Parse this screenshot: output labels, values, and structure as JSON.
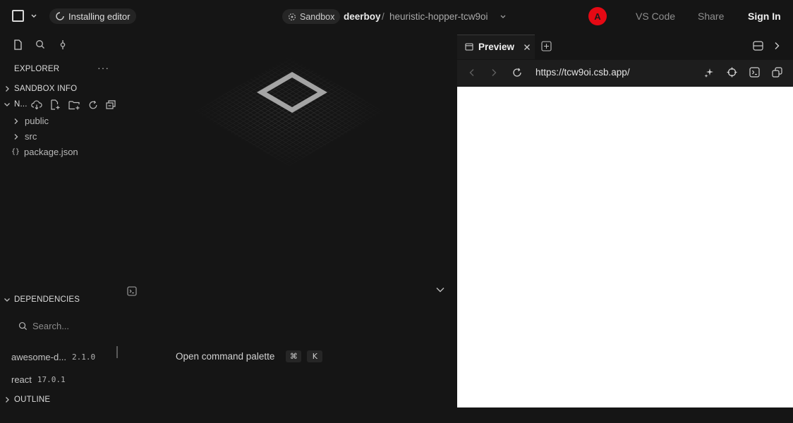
{
  "header": {
    "install_status": "Installing editor",
    "sandbox_label": "Sandbox",
    "owner": "deerboy",
    "separator": "/",
    "sandbox_name": "heuristic-hopper-tcw9oi",
    "avatar_initial": "A",
    "avatar_color": "#e50914",
    "vscode_label": "VS Code",
    "share_label": "Share",
    "signin_label": "Sign In"
  },
  "sidebar": {
    "explorer_title": "EXPLORER",
    "more_label": "···",
    "sandbox_info": "SANDBOX INFO",
    "folder_label": "N...",
    "files": [
      {
        "name": "public",
        "type": "folder"
      },
      {
        "name": "src",
        "type": "folder"
      },
      {
        "name": "package.json",
        "type": "json"
      }
    ],
    "dependencies_title": "DEPENDENCIES",
    "search_placeholder": "Search...",
    "dependencies": [
      {
        "name": "awesome-d...",
        "version": "2.1.0"
      },
      {
        "name": "react",
        "version": "17.0.1"
      }
    ],
    "outline_title": "OUTLINE"
  },
  "editor": {
    "command_palette_label": "Open command palette",
    "shortcut_keys": [
      "⌘",
      "K"
    ]
  },
  "preview": {
    "tab_label": "Preview",
    "url": "https://tcw9oi.csb.app/"
  },
  "icons": [
    "menu-square-icon",
    "spinner-icon",
    "sandbox-icon",
    "chevron-down-icon",
    "file-icon",
    "search-icon",
    "git-icon",
    "cloud-download-icon",
    "new-file-icon",
    "new-folder-icon",
    "refresh-icon",
    "collapse-icon",
    "terminal-icon",
    "browser-tab-icon",
    "add-tab-icon",
    "layout-icon",
    "chevron-right-icon",
    "back-icon",
    "forward-icon",
    "reload-icon",
    "sparkle-icon",
    "crosshair-icon",
    "console-icon",
    "open-window-icon"
  ]
}
